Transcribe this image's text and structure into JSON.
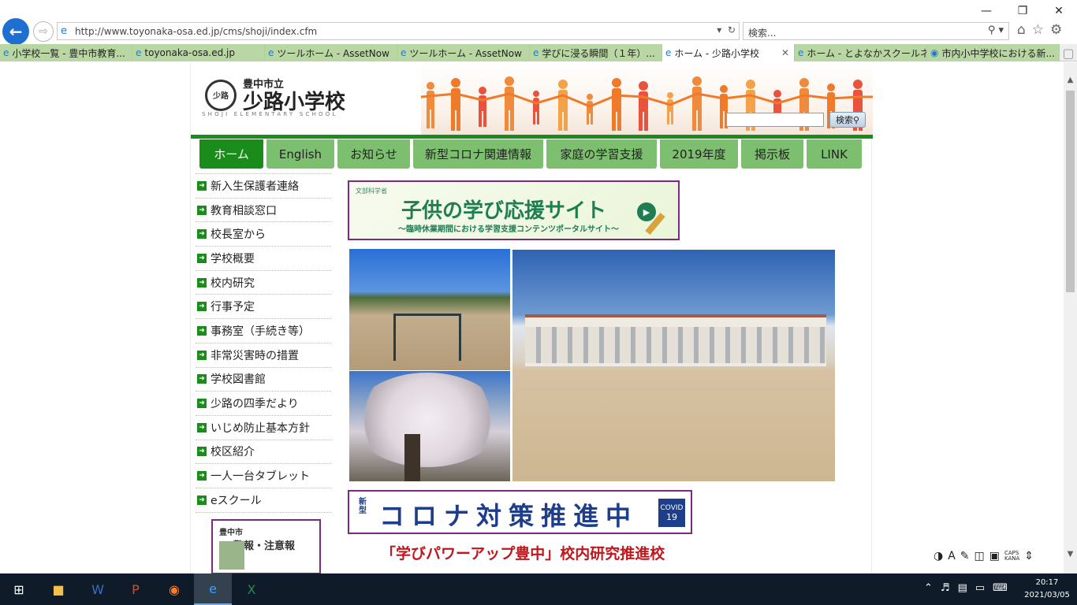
{
  "browser": {
    "url": "http://www.toyonaka-osa.ed.jp/cms/shoji/index.cfm",
    "search_placeholder": "検索...",
    "tabs": [
      {
        "label": "小学校一覧 - 豊中市教育...",
        "active": false
      },
      {
        "label": "toyonaka-osa.ed.jp",
        "active": false
      },
      {
        "label": "ツールホーム - AssetNow",
        "active": false
      },
      {
        "label": "ツールホーム - AssetNow",
        "active": false
      },
      {
        "label": "学びに浸る瞬間（１年）...",
        "active": false
      },
      {
        "label": "ホーム - 少路小学校",
        "active": true
      },
      {
        "label": "ホーム - とよなかスクールネット",
        "active": false
      },
      {
        "label": "市内小中学校における新...",
        "active": false
      }
    ]
  },
  "header": {
    "city": "豊中市立",
    "school_name": "少路小学校",
    "school_name_en": "SHOJI ELEMENTARY SCHOOL",
    "emblem_text": "少路",
    "search_button": "検索"
  },
  "global_nav": [
    {
      "label": "ホーム",
      "active": true
    },
    {
      "label": "English",
      "active": false
    },
    {
      "label": "お知らせ",
      "active": false
    },
    {
      "label": "新型コロナ関連情報",
      "active": false
    },
    {
      "label": "家庭の学習支援",
      "active": false
    },
    {
      "label": "2019年度",
      "active": false
    },
    {
      "label": "掲示板",
      "active": false
    },
    {
      "label": "LINK",
      "active": false
    }
  ],
  "side_nav": [
    "新入生保護者連絡",
    "教育相談窓口",
    "校長室から",
    "学校概要",
    "校内研究",
    "行事予定",
    "事務室（手続き等）",
    "非常災害時の措置",
    "学校図書館",
    "少路の四季だより",
    "いじめ防止基本方針",
    "校区紹介",
    "一人一台タブレット",
    "eスクール"
  ],
  "alert_banner": {
    "line1": "豊中市",
    "line2": "警報・注意報"
  },
  "mext_banner": {
    "ministry": "文部科学省",
    "title": "子供の学び応援サイト",
    "subtitle": "〜臨時休業期間における学習支援コンテンツポータルサイト〜"
  },
  "corona_banner": {
    "small": "新型",
    "main": "コロナ対策推進中",
    "covid": "COVID",
    "covid_num": "19"
  },
  "learning_title": "「学びパワーアップ豊中」校内研究推進校",
  "ime": {
    "caps": "CAPS",
    "kana": "KANA"
  },
  "taskbar": {
    "time": "20:17",
    "date": "2021/03/05"
  },
  "colors": {
    "nav_green": "#7cbf6e",
    "nav_active": "#1a8c1a",
    "banner_border": "#7a2a80",
    "title_red": "#c0171c"
  }
}
